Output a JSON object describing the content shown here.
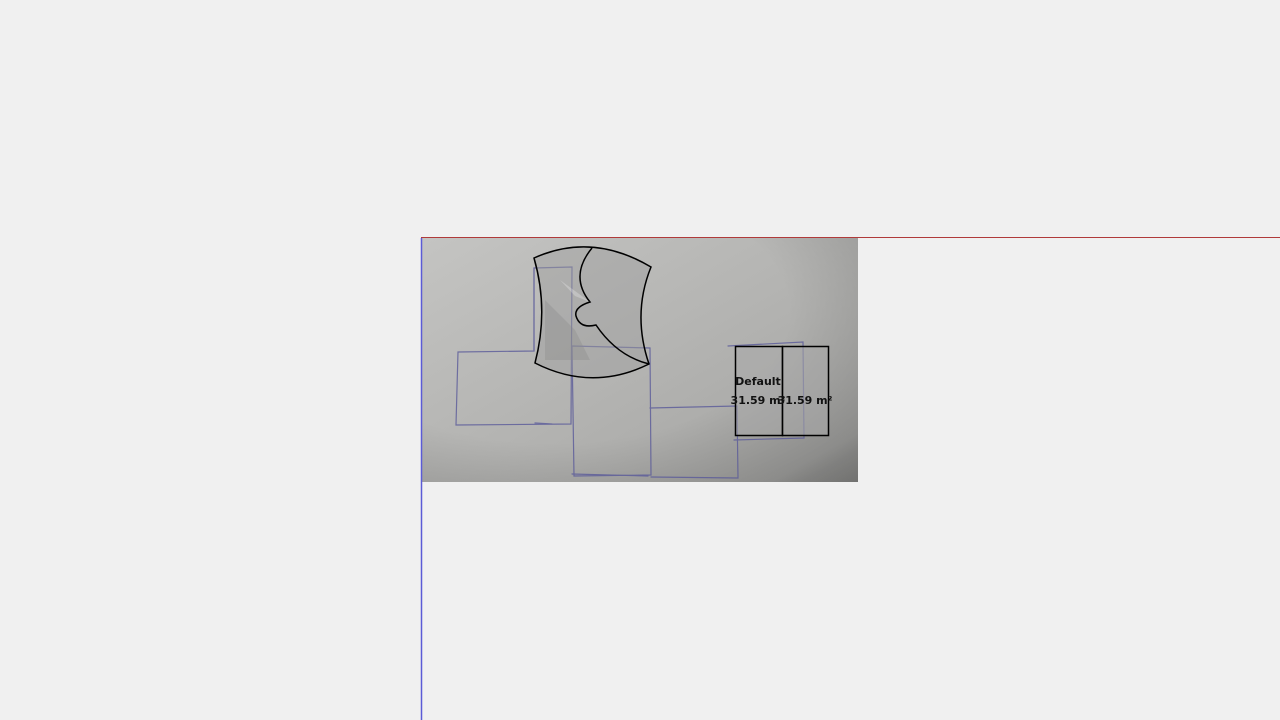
{
  "colors": {
    "background": "#f0f0f0",
    "x_axis": "#b03a3a",
    "y_axis": "#5b5bd6",
    "wall_stroke": "#000000",
    "room_fill": "#a9a9a9",
    "sketch_ink": "#5a5a9a"
  },
  "rooms": [
    {
      "name": "Default",
      "area": "31.59 m²"
    },
    {
      "name": "",
      "area": "31.59 m²"
    }
  ]
}
